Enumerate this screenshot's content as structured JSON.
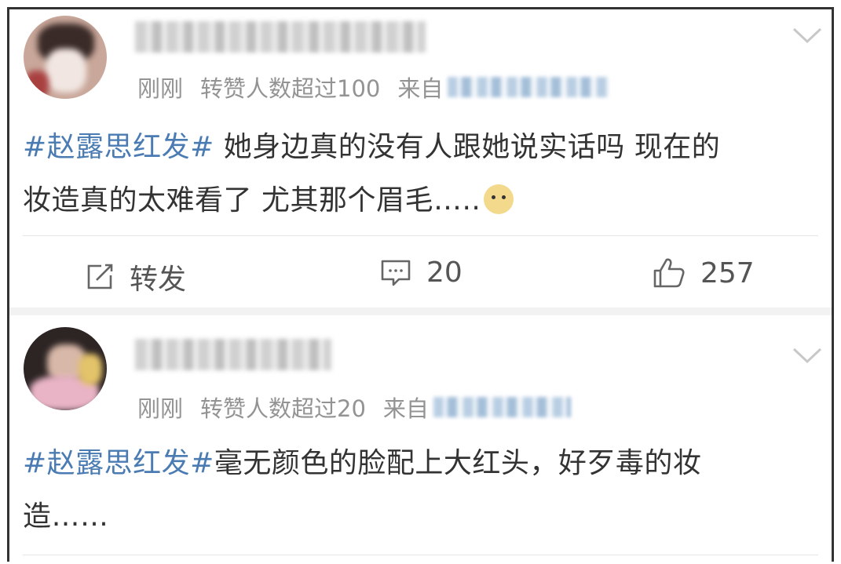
{
  "posts": [
    {
      "meta": {
        "time": "刚刚",
        "repost_note": "转赞人数超过100",
        "from_label": "来自"
      },
      "content": {
        "topic": "#赵露思红发#",
        "text_line1": " 她身边真的没有人跟她说实话吗 现在的",
        "text_line2": "妆造真的太难看了 尤其那个眉毛…..",
        "emoji": "doge-emoji"
      },
      "actions": {
        "repost_label": "转发",
        "comment_count": "20",
        "like_count": "257"
      }
    },
    {
      "meta": {
        "time": "刚刚",
        "repost_note": "转赞人数超过20",
        "from_label": "来自"
      },
      "content": {
        "topic": "#赵露思红发#",
        "text_line1": "毫无颜色的脸配上大红头，好歹毒的妆",
        "text_line2": "造……"
      }
    }
  ],
  "icons": {
    "dropdown": "chevron-down-icon",
    "repost": "edit-share-icon",
    "comment": "comment-bubble-icon",
    "like": "thumbs-up-icon"
  },
  "colors": {
    "topic": "#4a7bb3",
    "meta": "#939393",
    "text": "#333333"
  }
}
